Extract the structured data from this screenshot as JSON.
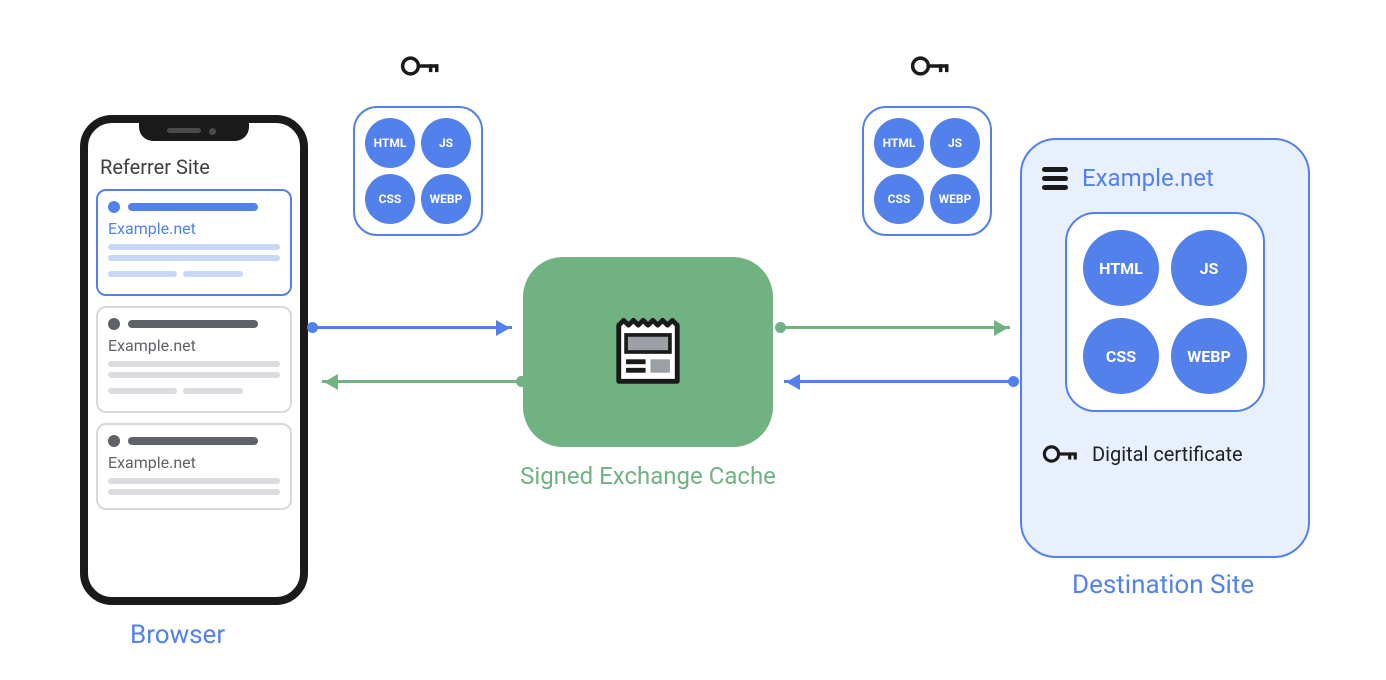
{
  "browser": {
    "referrer_title": "Referrer Site",
    "cards": [
      {
        "site": "Example.net",
        "selected": true
      },
      {
        "site": "Example.net",
        "selected": false
      },
      {
        "site": "Example.net",
        "selected": false
      }
    ],
    "label": "Browser"
  },
  "packages": {
    "floating": {
      "assets": [
        "HTML",
        "JS",
        "CSS",
        "WEBP"
      ]
    }
  },
  "cache": {
    "label": "Signed Exchange Cache"
  },
  "destination": {
    "title": "Example.net",
    "assets": [
      "HTML",
      "JS",
      "CSS",
      "WEBP"
    ],
    "certificate_label": "Digital certificate",
    "label": "Destination Site"
  },
  "colors": {
    "blue": "#5381ec",
    "green": "#71b282",
    "light_blue_bg": "#e8f0fe",
    "text_dark": "#202124",
    "gray": "#5f6368"
  }
}
